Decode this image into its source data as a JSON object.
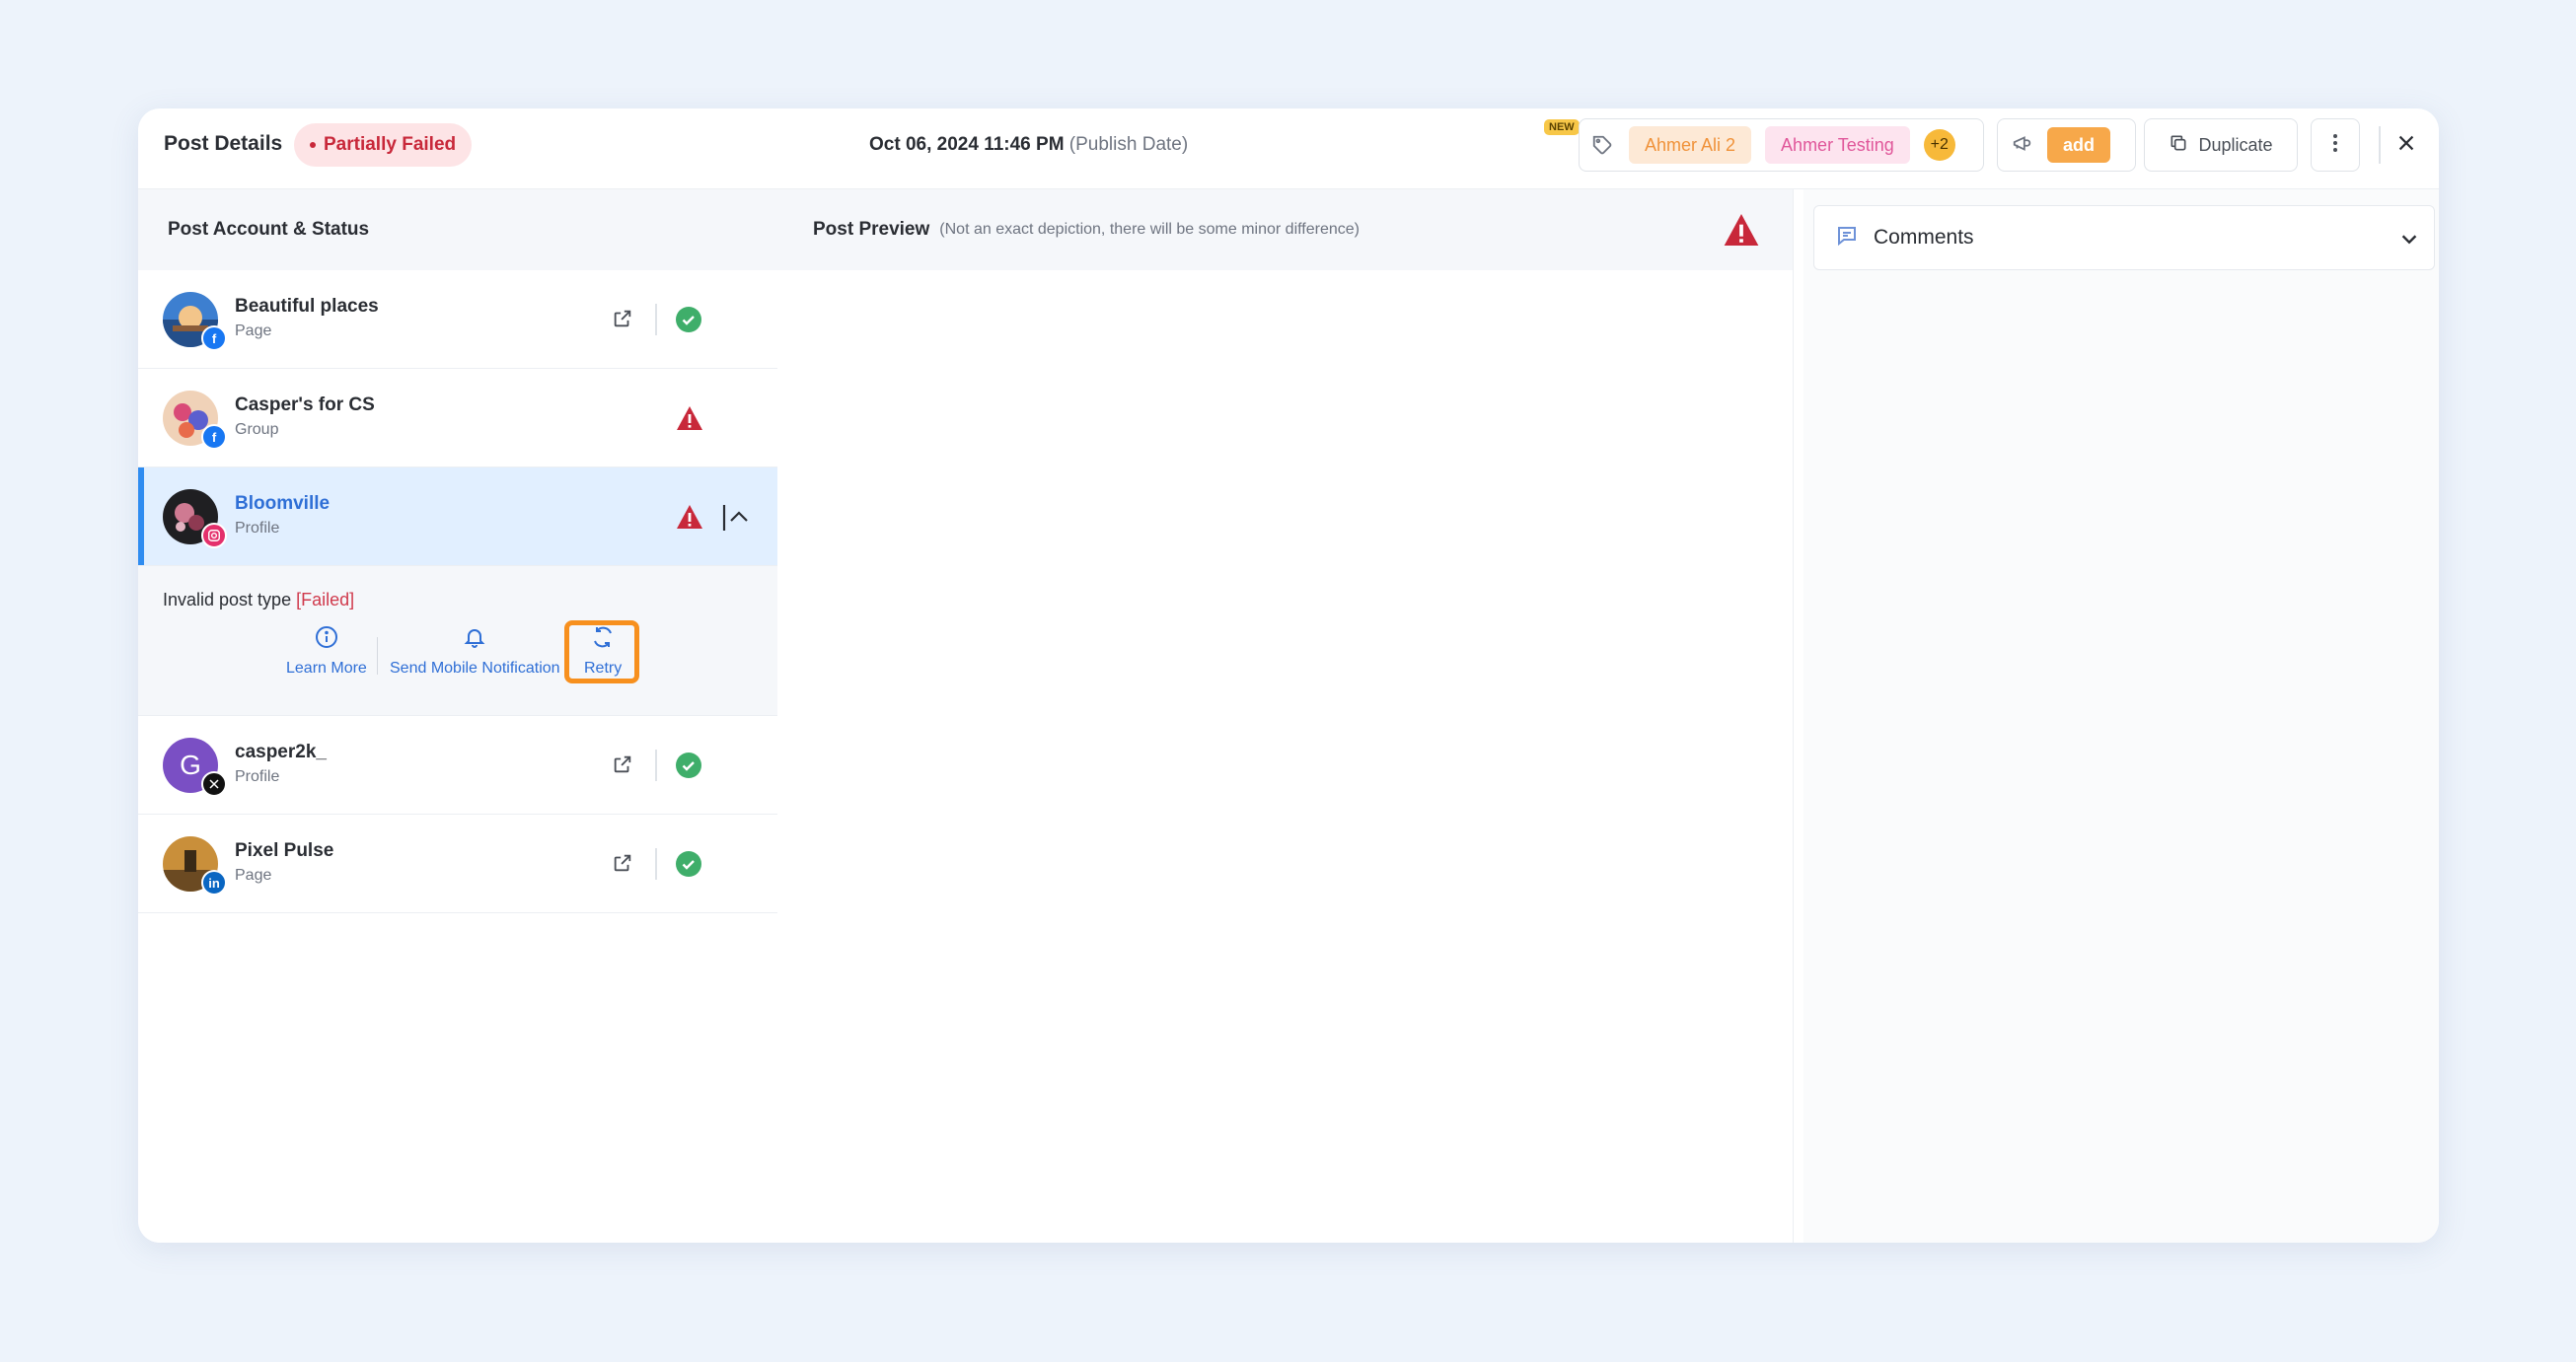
{
  "header": {
    "title": "Post Details",
    "status": "Partially Failed",
    "publish_date": "Oct 06, 2024 11:46 PM",
    "publish_date_suffix": "(Publish Date)",
    "new_badge": "NEW",
    "labels": [
      "Ahmer Ali 2",
      "Ahmer Testing"
    ],
    "labels_more": "+2",
    "campaign_add": "add",
    "duplicate": "Duplicate"
  },
  "accounts_panel": {
    "title": "Post Account & Status",
    "accounts": [
      {
        "name": "Beautiful places",
        "type": "Page",
        "platform": "facebook",
        "status": "published"
      },
      {
        "name": "Casper's for CS",
        "type": "Group",
        "platform": "facebook",
        "status": "failed"
      },
      {
        "name": "Bloomville",
        "type": "Profile",
        "platform": "instagram",
        "status": "failed"
      },
      {
        "name": "casper2k_",
        "type": "Profile",
        "platform": "x",
        "status": "published",
        "initial": "G"
      },
      {
        "name": "Pixel Pulse",
        "type": "Page",
        "platform": "linkedin",
        "status": "published"
      }
    ],
    "error": {
      "message": "Invalid post type",
      "tag": "[Failed]",
      "learn_more": "Learn More",
      "send_notification": "Send Mobile Notification",
      "retry": "Retry"
    }
  },
  "preview": {
    "title": "Post Preview",
    "note": "(Not an exact depiction, there will be some minor difference)"
  },
  "comments": {
    "label": "Comments"
  },
  "colors": {
    "accent": "#2f6fd6",
    "failed": "#c8283a",
    "success": "#3fae6a",
    "highlight": "#f7901e"
  }
}
